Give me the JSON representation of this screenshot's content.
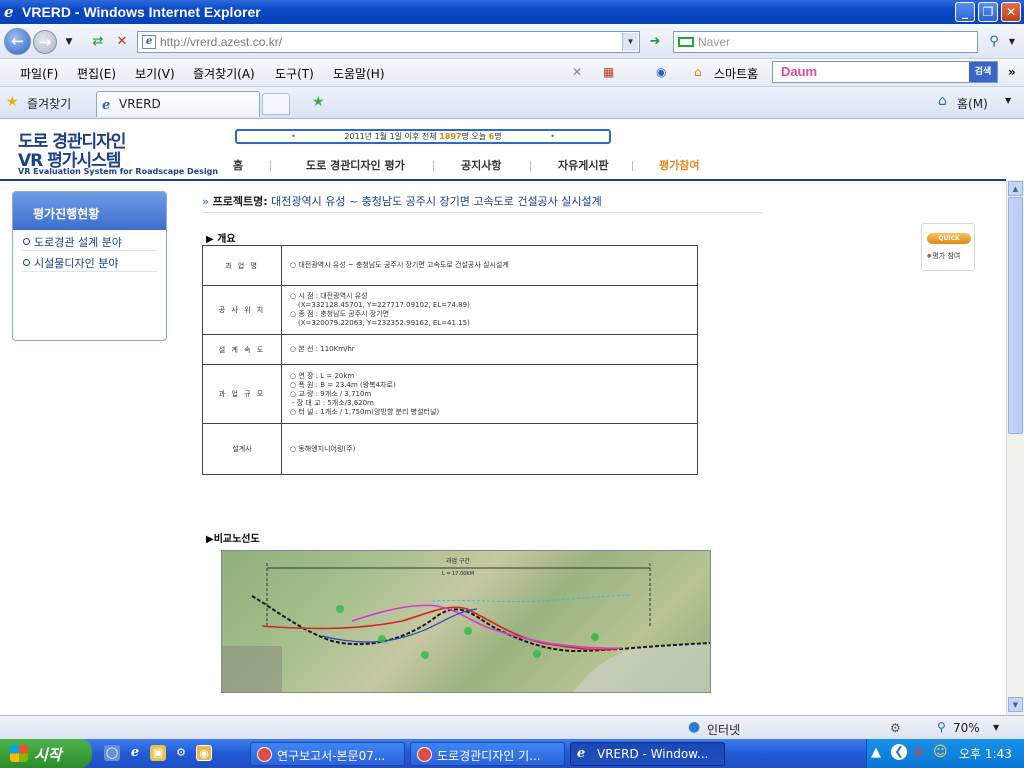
{
  "window": {
    "title": "VRERD - Windows Internet Explorer",
    "controls": [
      "_",
      "❐",
      "✕"
    ]
  },
  "address_bar": {
    "url": "http://vrerd.azest.co.kr/",
    "search_placeholder": "Naver"
  },
  "menu": {
    "items": [
      "파일(F)",
      "편집(E)",
      "보기(V)",
      "즐겨찾기(A)",
      "도구(T)",
      "도움말(H)"
    ],
    "smarthome": "스마트홈",
    "daum_logo": "Daum",
    "daum_search_button": "검색"
  },
  "favorites_bar": {
    "label": "즐겨찾기",
    "tab_title": "VRERD",
    "home": "홈(M)"
  },
  "site": {
    "logo_line1": "도로 경관디자인",
    "logo_line2": "VR 평가시스템",
    "logo_sub": "VR Evaluation System for Roadscape Design",
    "visitor_prefix": "2011년 1월 1일 이후 전체",
    "visitor_total": "1897",
    "visitor_mid": "명 오늘",
    "visitor_today": "6",
    "visitor_suffix": "명",
    "nav": [
      "홈",
      "도로 경관디자인 평가",
      "공지사항",
      "자유게시판",
      "평가참여"
    ],
    "active_nav": "평가참여"
  },
  "sidebar": {
    "title": "평가진행현황",
    "items": [
      "도로경관 설계 분야",
      "시설물디자인 분야"
    ]
  },
  "project": {
    "label": "프로젝트명:",
    "name": "대전광역시 유성 ~ 충청남도 공주시 장기면 고속도로 건설공사 실시설계"
  },
  "overview": {
    "heading": "▶ 개요",
    "rows": [
      {
        "key": "과 업 명",
        "lines": [
          "○ 대전광역시 유성 ~ 충청남도 공주시 장기면 고속도로 건설공사 실시설계"
        ]
      },
      {
        "key": "공 사 위 치",
        "lines": [
          "○ 시 점 : 대전광역시 유성",
          "(X=332128.45701, Y=227717.09102, EL=74.89)",
          "○ 종 점 : 충청남도 공주시 장기면",
          "(X=320079.22063, Y=232352.99162, EL=41.15)"
        ]
      },
      {
        "key": "설 계 속 도",
        "lines": [
          "○ 본 선 : 110Km/hr"
        ]
      },
      {
        "key": "과 업 규 모",
        "lines": [
          "○ 연 장 : L = 20km",
          "○ 폭 원 : B = 23.4m (왕복4차로)",
          "○ 교 량 : 9개소 / 3,710m",
          "- 장 대 교 : 5개소/3,620m",
          "○ 터 널 : 1개소 / 1,750m(양방향 분리 병설터널)"
        ]
      },
      {
        "key": "설계사",
        "lines": [
          "○ 동해엔지니어링(주)"
        ]
      }
    ]
  },
  "map": {
    "heading": "▶비교노선도",
    "length_label": "과업 구간",
    "length_value": "L = 17.00KM"
  },
  "quick": {
    "button": "QUICK",
    "link": "평가 참여"
  },
  "status_bar": {
    "zone": "인터넷",
    "zoom": "70%"
  },
  "taskbar": {
    "start": "시작",
    "buttons": [
      "연구보고서-본문07...",
      "도로경관디자인 기...",
      "VRERD - Window..."
    ],
    "clock": "오후 1:43"
  },
  "colors": {
    "title_blue": "#0a46c6",
    "brand_navy": "#1b3f8a",
    "nav_active": "#e6891c",
    "counter_highlight": "#d18b12"
  }
}
